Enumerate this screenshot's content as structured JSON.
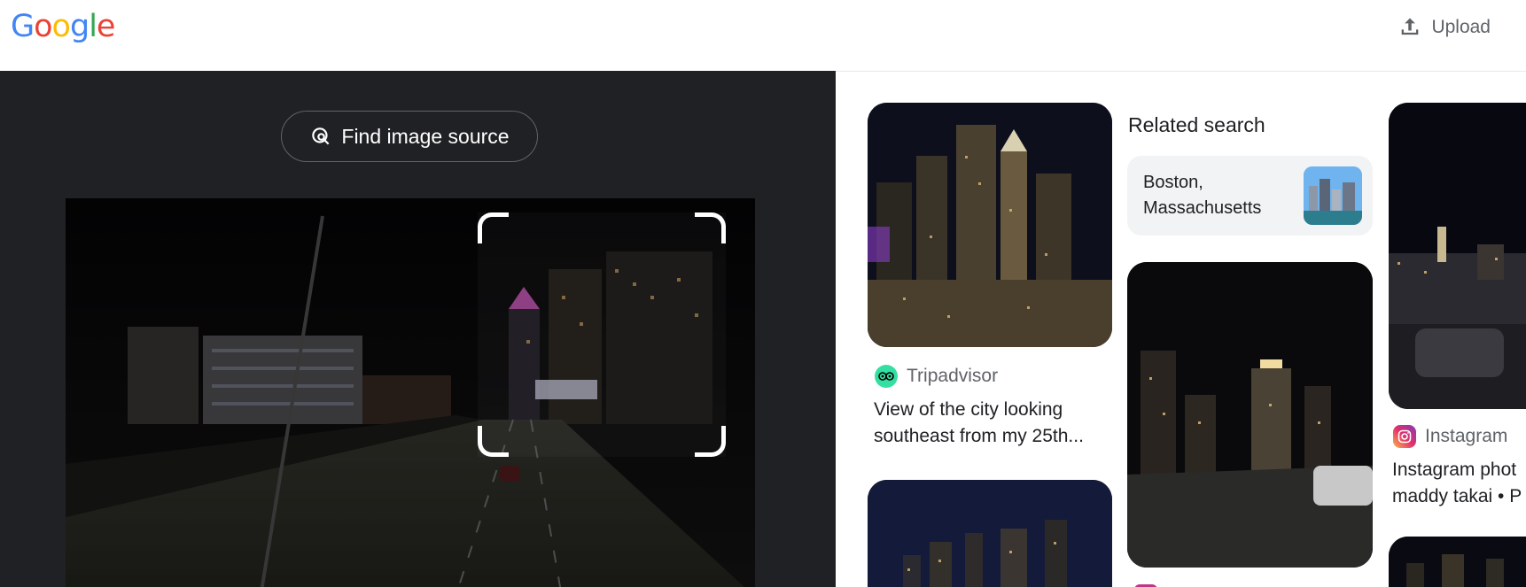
{
  "header": {
    "logo_text": "Google",
    "upload_label": "Upload"
  },
  "lens": {
    "find_source_label": "Find image source"
  },
  "results": {
    "cards": [
      {
        "source": "Tripadvisor",
        "title_line1": "View of the city looking",
        "title_line2": "southeast from my 25th..."
      },
      {
        "source": "Instagram",
        "title_line1": "Instagram phot",
        "title_line2": "maddy takai • P"
      }
    ],
    "related": {
      "heading": "Related search",
      "chip_line1": "Boston,",
      "chip_line2": "Massachusetts"
    }
  },
  "colors": {
    "google_blue": "#4285F4",
    "google_red": "#EA4335",
    "google_yellow": "#FBBC05",
    "google_green": "#34A853",
    "dark_panel": "#202124",
    "tripadvisor_green": "#34E0A1"
  },
  "icons": [
    "upload-icon",
    "lens-search-icon",
    "tripadvisor-icon",
    "instagram-icon"
  ]
}
